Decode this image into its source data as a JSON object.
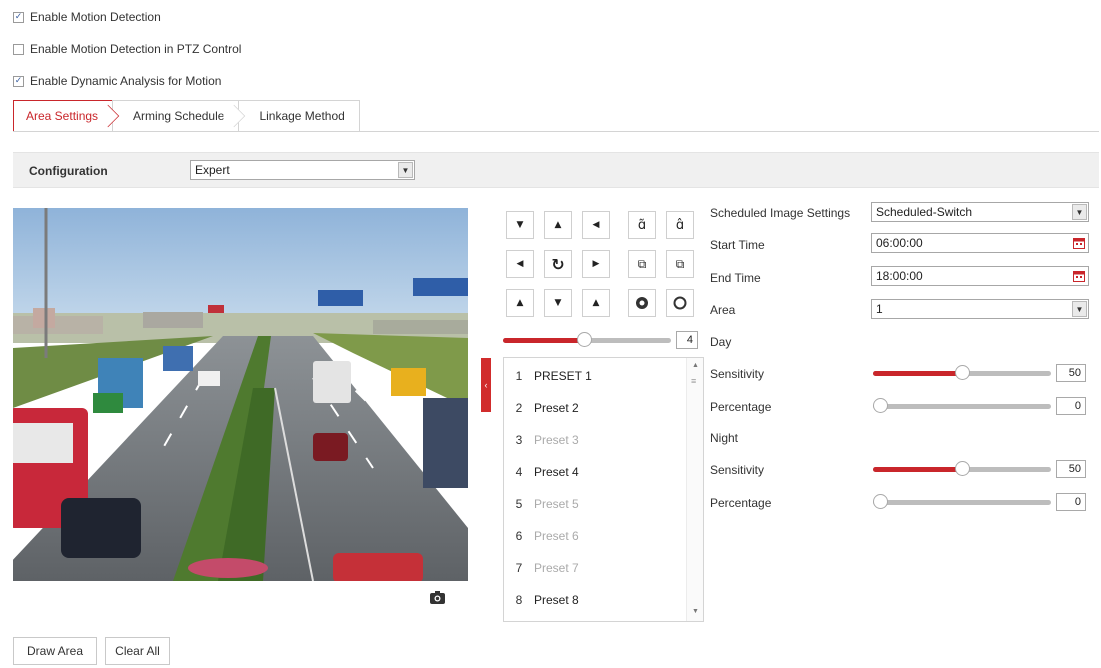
{
  "checkboxes": [
    {
      "label": "Enable Motion Detection",
      "checked": true
    },
    {
      "label": "Enable Motion Detection in PTZ Control",
      "checked": false
    },
    {
      "label": "Enable Dynamic Analysis for Motion",
      "checked": true
    }
  ],
  "tabs": [
    {
      "label": "Area Settings",
      "active": true
    },
    {
      "label": "Arming Schedule",
      "active": false
    },
    {
      "label": "Linkage Method",
      "active": false
    }
  ],
  "configuration": {
    "label": "Configuration",
    "value": "Expert"
  },
  "ptz": {
    "icons": [
      "arrow-up-left-icon",
      "arrow-up-icon",
      "arrow-up-right-icon",
      "zoom-in-icon",
      "zoom-out-icon",
      "arrow-left-icon",
      "auto-pan-icon",
      "arrow-right-icon",
      "focus-near-icon",
      "focus-far-icon",
      "arrow-down-left-icon",
      "arrow-down-icon",
      "arrow-down-right-icon",
      "iris-open-icon",
      "iris-close-icon"
    ],
    "speed_value": "4",
    "speed_fraction": 0.48
  },
  "presets": [
    {
      "num": "1",
      "name": "PRESET 1",
      "set": true
    },
    {
      "num": "2",
      "name": "Preset 2",
      "set": true
    },
    {
      "num": "3",
      "name": "Preset 3",
      "set": false
    },
    {
      "num": "4",
      "name": "Preset 4",
      "set": true
    },
    {
      "num": "5",
      "name": "Preset 5",
      "set": false
    },
    {
      "num": "6",
      "name": "Preset 6",
      "set": false
    },
    {
      "num": "7",
      "name": "Preset 7",
      "set": false
    },
    {
      "num": "8",
      "name": "Preset 8",
      "set": true
    }
  ],
  "schedule": {
    "scheduled_label": "Scheduled Image Settings",
    "scheduled_value": "Scheduled-Switch",
    "start_label": "Start Time",
    "start_value": "06:00:00",
    "end_label": "End Time",
    "end_value": "18:00:00",
    "area_label": "Area",
    "area_value": "1"
  },
  "day": {
    "heading": "Day",
    "sensitivity_label": "Sensitivity",
    "sensitivity_value": "50",
    "sensitivity_fraction": 0.5,
    "percentage_label": "Percentage",
    "percentage_value": "0",
    "percentage_fraction": 0.0
  },
  "night": {
    "heading": "Night",
    "sensitivity_label": "Sensitivity",
    "sensitivity_value": "50",
    "sensitivity_fraction": 0.5,
    "percentage_label": "Percentage",
    "percentage_value": "0",
    "percentage_fraction": 0.0
  },
  "buttons": {
    "draw_area": "Draw Area",
    "clear_all": "Clear All"
  },
  "colors": {
    "accent": "#c9262b",
    "collapse_tab": "#d12c2c"
  }
}
